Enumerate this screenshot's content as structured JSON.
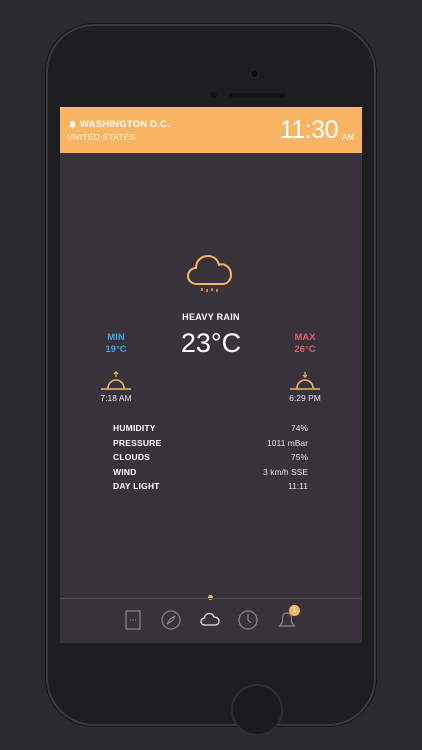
{
  "header": {
    "city": "WASHINGTON D.C.",
    "country": "UNITED STATES",
    "time": "11:30",
    "ampm": "AM"
  },
  "current": {
    "condition": "HEAVY RAIN",
    "temperature": "23°C",
    "icon": "cloud-rain-icon"
  },
  "min": {
    "label": "MIN",
    "value": "19°C"
  },
  "max": {
    "label": "MAX",
    "value": "26°C"
  },
  "sun": {
    "sunrise": "7:18 AM",
    "sunset": "6:29 PM"
  },
  "details": [
    {
      "label": "HUMIDITY",
      "value": "74%"
    },
    {
      "label": "PRESSURE",
      "value": "1011 mBar"
    },
    {
      "label": "CLOUDS",
      "value": "75%"
    },
    {
      "label": "WIND",
      "value": "3 km/h SSE"
    },
    {
      "label": "DAY LIGHT",
      "value": "11:11"
    }
  ],
  "tabbar": {
    "items": [
      "list-icon",
      "compass-icon",
      "cloud-icon",
      "clock-icon",
      "bell-icon"
    ],
    "active": "cloud-icon",
    "badge": "1"
  },
  "colors": {
    "accent": "#f7b462",
    "min": "#3aa6e6",
    "max": "#e25a67",
    "background": "#38333b"
  }
}
